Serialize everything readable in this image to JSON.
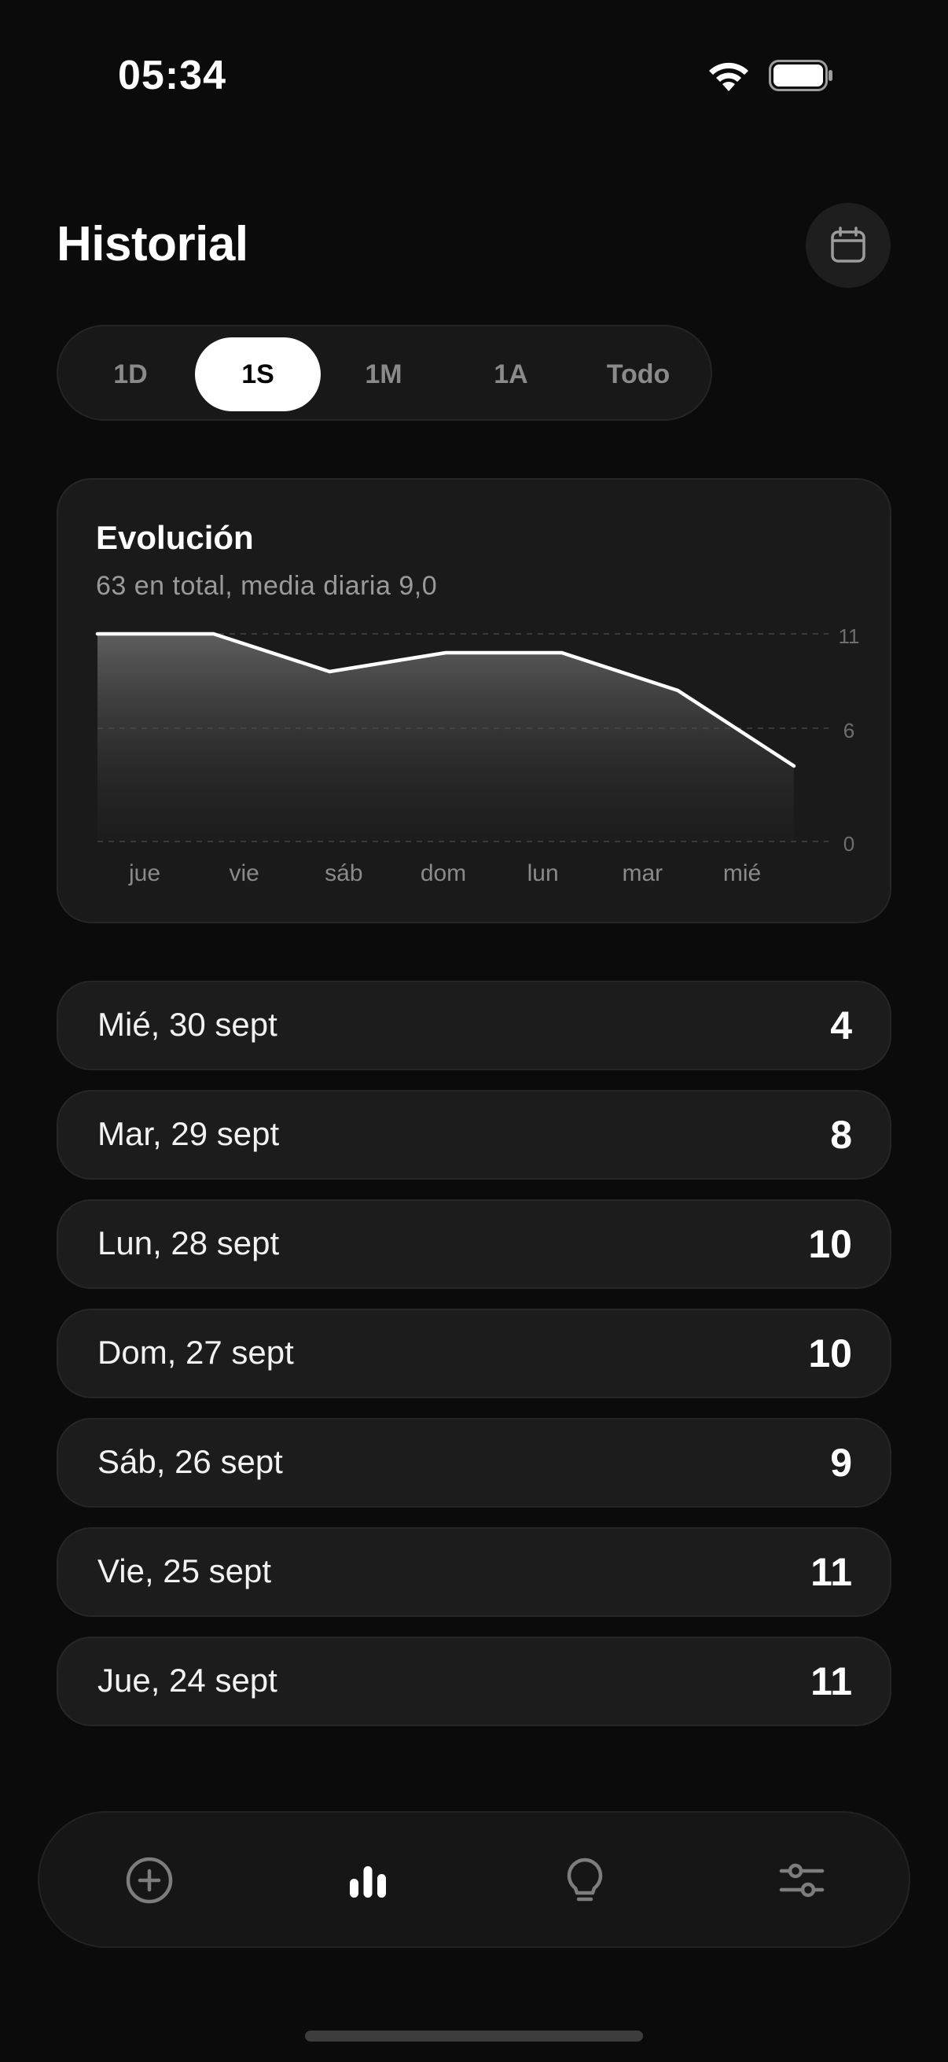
{
  "status_bar": {
    "time": "05:34",
    "wifi_icon": "wifi-icon",
    "battery_icon": "battery-icon"
  },
  "header": {
    "title": "Historial",
    "calendar_icon": "calendar-icon"
  },
  "range_tabs": [
    {
      "label": "1D",
      "active": false
    },
    {
      "label": "1S",
      "active": true
    },
    {
      "label": "1M",
      "active": false
    },
    {
      "label": "1A",
      "active": false
    },
    {
      "label": "Todo",
      "active": false
    }
  ],
  "chart_card": {
    "title": "Evolución",
    "subtitle": "63 en total, media diaria 9,0"
  },
  "chart_data": {
    "type": "area",
    "categories": [
      "jue",
      "vie",
      "sáb",
      "dom",
      "lun",
      "mar",
      "mié"
    ],
    "series": [
      {
        "values": [
          11,
          11,
          9,
          10,
          10,
          8,
          4
        ]
      }
    ],
    "yticks": [
      "11",
      "6",
      "0"
    ],
    "ylim": [
      0,
      11
    ],
    "grid": true
  },
  "days": [
    {
      "label": "Mié, 30 sept",
      "value": "4"
    },
    {
      "label": "Mar, 29 sept",
      "value": "8"
    },
    {
      "label": "Lun, 28 sept",
      "value": "10"
    },
    {
      "label": "Dom, 27 sept",
      "value": "10"
    },
    {
      "label": "Sáb, 26 sept",
      "value": "9"
    },
    {
      "label": "Vie, 25 sept",
      "value": "11"
    },
    {
      "label": "Jue, 24 sept",
      "value": "11"
    }
  ],
  "nav": [
    {
      "icon": "add-circle-icon",
      "active": false
    },
    {
      "icon": "bar-chart-icon",
      "active": true
    },
    {
      "icon": "lightbulb-icon",
      "active": false
    },
    {
      "icon": "sliders-icon",
      "active": false
    }
  ],
  "colors": {
    "background": "#0b0b0b",
    "card": "#1a1a1a",
    "accent": "#ffffff",
    "muted": "#8a8a8a"
  }
}
